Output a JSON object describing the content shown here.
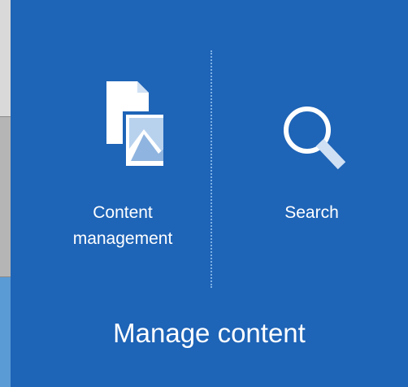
{
  "tile": {
    "title": "Manage content",
    "accent": "#1e64b7",
    "actions": [
      {
        "label": "Content management",
        "icon": "documents-image-icon"
      },
      {
        "label": "Search",
        "icon": "search-icon"
      }
    ]
  }
}
